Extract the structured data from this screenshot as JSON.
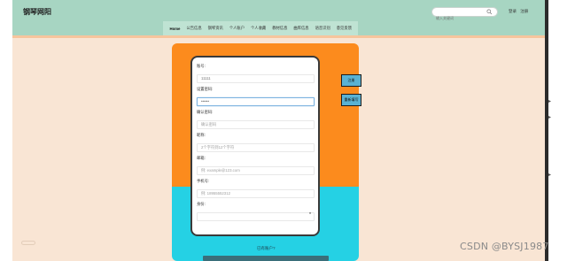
{
  "header": {
    "site_title": "钢琴网阳",
    "search": {
      "placeholder": "输入关键词"
    },
    "auth": {
      "login": "登录",
      "register": "注册"
    },
    "nav": [
      "Home",
      "公告信息",
      "钢琴资讯",
      "个人账户",
      "个人收藏",
      "教材信息",
      "曲库信息",
      "语音识别",
      "意见反馈"
    ]
  },
  "form": {
    "account": {
      "label": "账号:",
      "value": "11111"
    },
    "password": {
      "label": "设置密码:",
      "value": "••••••"
    },
    "confirm_password": {
      "label": "确认密码:",
      "placeholder": "确认密码"
    },
    "nickname": {
      "label": "昵称:",
      "placeholder": "2个字符到12个字符"
    },
    "email": {
      "label": "邮箱:",
      "placeholder": "例: example@123.com"
    },
    "phone": {
      "label": "手机号:",
      "placeholder": "例: 18955552312"
    },
    "identity": {
      "label": "身份:",
      "value": ""
    }
  },
  "buttons": {
    "register": "注册",
    "reset": "重新填写"
  },
  "login_link": "已有账户?",
  "watermark": "CSDN @BYSJ1987",
  "colors": {
    "header": "#a7d5c2",
    "card_orange": "#fc8b1d",
    "card_cyan": "#25d1e4",
    "page_bg": "#f9e5d4"
  },
  "icons": {
    "search": "search-icon",
    "select": "chevron-down-icon"
  }
}
